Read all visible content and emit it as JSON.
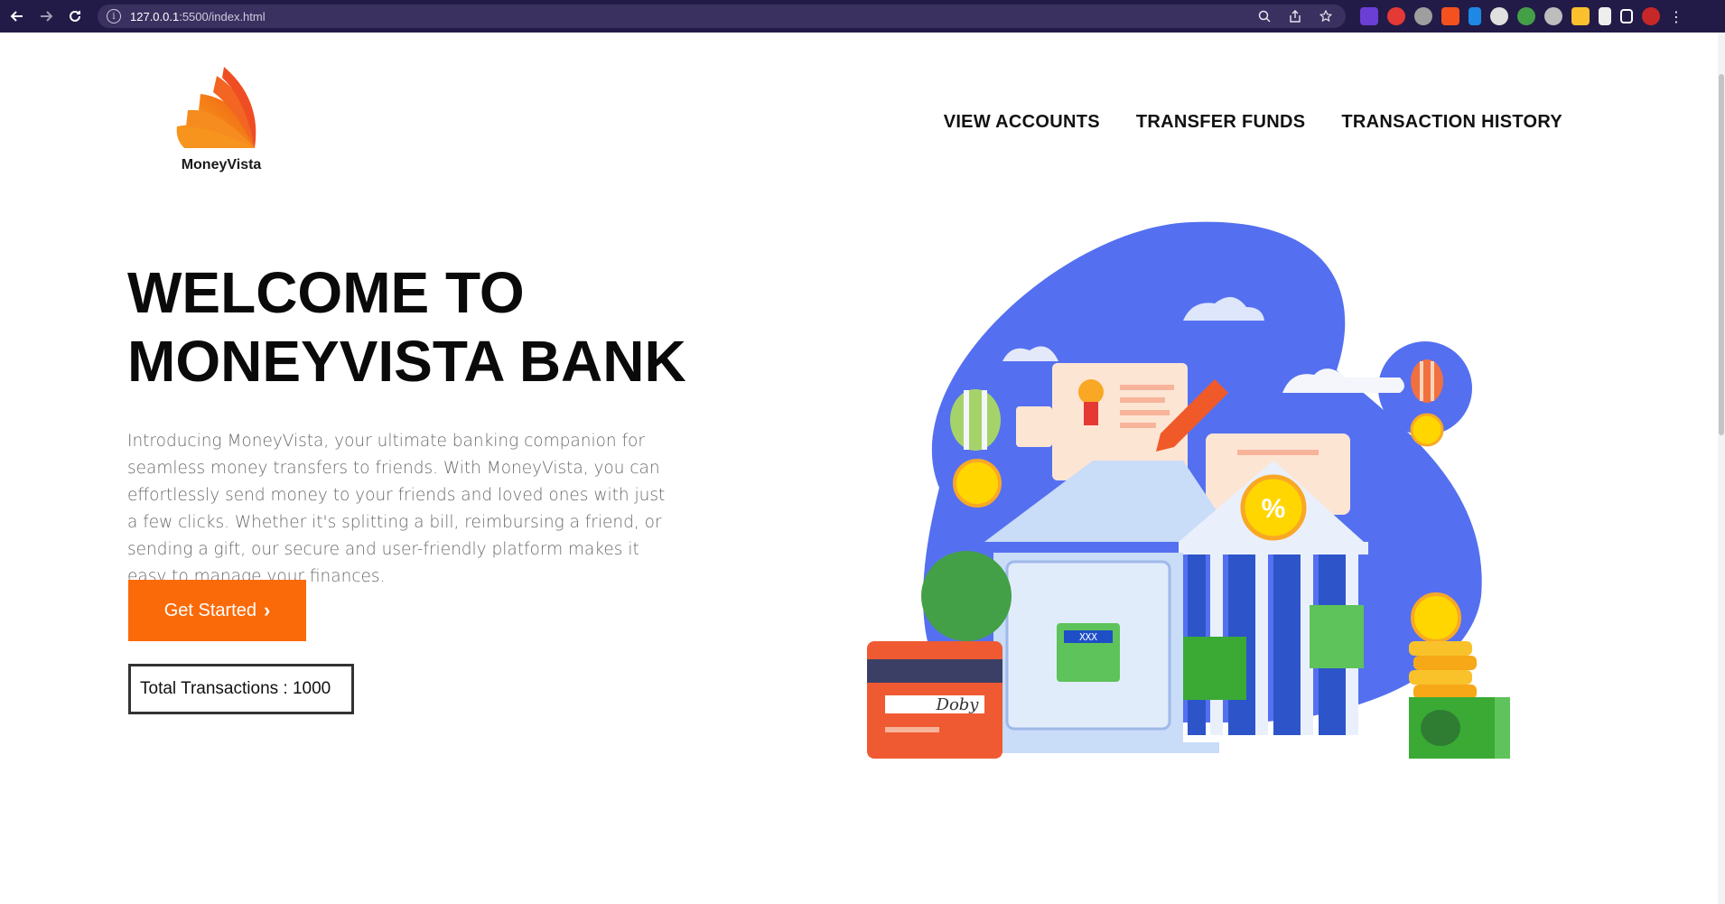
{
  "browser": {
    "url_host": "127.0.0.1",
    "url_rest": ":5500/index.html",
    "back_icon": "arrow-left-icon",
    "forward_icon": "arrow-right-icon",
    "reload_icon": "reload-icon"
  },
  "logo": {
    "text": "MoneyVista"
  },
  "nav": {
    "items": [
      {
        "label": "VIEW ACCOUNTS"
      },
      {
        "label": "TRANSFER FUNDS"
      },
      {
        "label": "TRANSACTION HISTORY"
      }
    ]
  },
  "hero": {
    "title_line1": "WELCOME TO",
    "title_line2": "MONEYVISTA BANK",
    "description": "Introducing MoneyVista, your ultimate banking companion for seamless money transfers to friends. With MoneyVista, you can effortlessly send money to your friends and loved ones with just a few clicks. Whether it's splitting a bill, reimbursing a friend, or sending a gift, our secure and user-friendly platform makes it easy to manage your finances.",
    "cta_label": "Get Started",
    "stats_label": "Total Transactions : 1000"
  },
  "illustration": {
    "card_signature": "Doby",
    "safe_display": "XXX"
  },
  "colors": {
    "accent": "#fb6a08",
    "blob": "#5470f0",
    "chrome": "#231b47"
  }
}
